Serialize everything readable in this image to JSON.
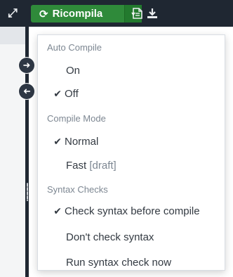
{
  "toolbar": {
    "recompile_label": "Ricompila",
    "icons": {
      "expand": "expand-arrows-icon",
      "recompile": "refresh-icon",
      "dropdown": "caret-down-icon",
      "logs": "document-icon",
      "download": "download-icon"
    }
  },
  "sidebar": {
    "icons": {
      "expand": "arrow-right-circle-icon",
      "collapse": "arrow-left-circle-icon"
    }
  },
  "menu": {
    "sections": [
      {
        "header": "Auto Compile",
        "items": [
          {
            "label": "On",
            "checked": false
          },
          {
            "label": "Off",
            "checked": true
          }
        ]
      },
      {
        "header": "Compile Mode",
        "items": [
          {
            "label": "Normal",
            "checked": true
          },
          {
            "label": "Fast",
            "suffix": "[draft]",
            "checked": false
          }
        ]
      },
      {
        "header": "Syntax Checks",
        "items": [
          {
            "label": "Check syntax before compile",
            "checked": true
          },
          {
            "label": "Don't check syntax",
            "checked": false
          },
          {
            "label": "Run syntax check now",
            "checked": false
          }
        ]
      }
    ]
  },
  "colors": {
    "toolbar_bg": "#1f2732",
    "recompile_green": "#2f8a3a",
    "menu_text": "#333a42",
    "menu_header": "#7d8792"
  }
}
